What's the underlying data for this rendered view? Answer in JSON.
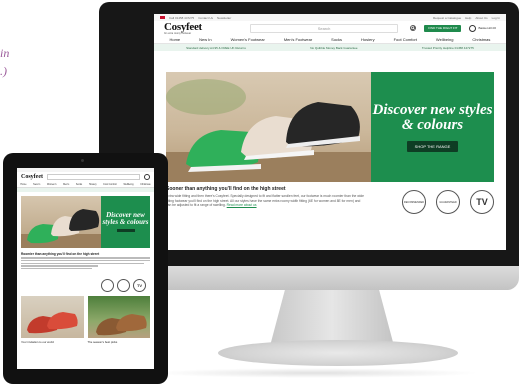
{
  "partial_caption": {
    "line1": "in",
    "line2": ".)"
  },
  "site": {
    "logo": "Cosyfeet",
    "logo_tagline": "for extra roomy footwear",
    "util_left": [
      "Call 01458 447275",
      "Contact Us",
      "Newsletter"
    ],
    "util_right": [
      "Request a Catalogue",
      "Help",
      "About Us",
      "Log In"
    ],
    "search_placeholder": "Search",
    "sizing_button": "FIND THE RIGHT FIT",
    "basket_label": "Basket £0.00",
    "nav": [
      "Home",
      "New In",
      "Women's Footwear",
      "Men's Footwear",
      "Socks",
      "Hosiery",
      "Foot Comfort",
      "Wellbeing",
      "Christmas"
    ],
    "strip": [
      "Standard delivery £4.95 & FREE UK Returns",
      "No Quibble Money Back Guarantee",
      "Trusted Priority Helpline 01458 447275"
    ],
    "hero_title": "Discover new styles & colours",
    "hero_button": "SHOP THE RANGE",
    "below_heading": "Sooner than anything you'll find on the high street",
    "below_body": "Extra wide fitting and then there's Cosyfeet. Specially designed to fit and flatter swollen feet, our footwear is much roomier than the wide fitting footwear you'll find on the high street. All our styles have the same extra roomy width fitting (6E for women and 8E for men) and can be adjusted to fit a range of swelling.",
    "below_link": "Read more about us",
    "badges": [
      "RECOMMENDED",
      "GUARANTEED",
      "TV"
    ]
  },
  "tablet": {
    "logo": "Cosyfeet",
    "nav": [
      "Home",
      "New In",
      "Women's",
      "Men's",
      "Socks",
      "Hosiery",
      "Foot Comfort",
      "Wellbeing",
      "Christmas"
    ],
    "hero_title": "Discover new styles & colours",
    "heading": "Roomier than anything you'll find on the high street",
    "badge_tv": "TV",
    "card1_title": "Your invitation to our world",
    "card2_title": "The season's best picks"
  },
  "colors": {
    "brand_green": "#1d8e4e",
    "dark_green": "#0e3d24",
    "caption_purple": "#9b5a9a"
  }
}
